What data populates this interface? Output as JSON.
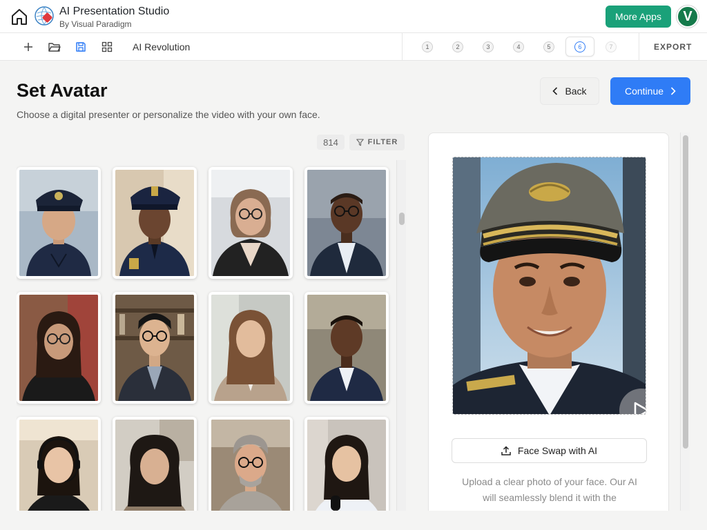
{
  "app": {
    "title": "AI Presentation Studio",
    "subtitle": "By Visual Paradigm",
    "more_apps_label": "More Apps",
    "user_initial": "V",
    "brand_color": "#1aa179"
  },
  "toolbar": {
    "icons": [
      "plus-icon",
      "folder-open-icon",
      "save-icon",
      "grid-icon"
    ],
    "document_name": "AI Revolution",
    "steps": [
      "1",
      "2",
      "3",
      "4",
      "5",
      "6",
      "7"
    ],
    "active_step": "6",
    "export_label": "EXPORT"
  },
  "page": {
    "title": "Set Avatar",
    "description": "Choose a digital presenter or personalize the video with your own face.",
    "back_label": "Back",
    "continue_label": "Continue",
    "accent_color": "#2f7cf6"
  },
  "library": {
    "count": "814",
    "filter_label": "FILTER",
    "avatars": [
      {
        "desc": "police-officer-woman",
        "hat": "police-cap"
      },
      {
        "desc": "police-officer-man",
        "hat": "police-cap"
      },
      {
        "desc": "woman-glasses-office",
        "hat": "none"
      },
      {
        "desc": "man-glasses-suit",
        "hat": "none"
      },
      {
        "desc": "woman-glasses-library",
        "hat": "none"
      },
      {
        "desc": "man-glasses-bookshelf",
        "hat": "none"
      },
      {
        "desc": "woman-long-hair-blazer",
        "hat": "none"
      },
      {
        "desc": "man-suit-office",
        "hat": "none"
      },
      {
        "desc": "woman-headset",
        "hat": "none"
      },
      {
        "desc": "woman-curly-hair",
        "hat": "none"
      },
      {
        "desc": "older-man-glasses",
        "hat": "none"
      },
      {
        "desc": "woman-reporter-microphone",
        "hat": "none"
      }
    ]
  },
  "preview": {
    "selected_avatar": "pilot-man-captain-hat",
    "face_swap_label": "Face Swap with AI",
    "upload_hint": "Upload a clear photo of your face. Our AI will seamlessly blend it with the"
  }
}
